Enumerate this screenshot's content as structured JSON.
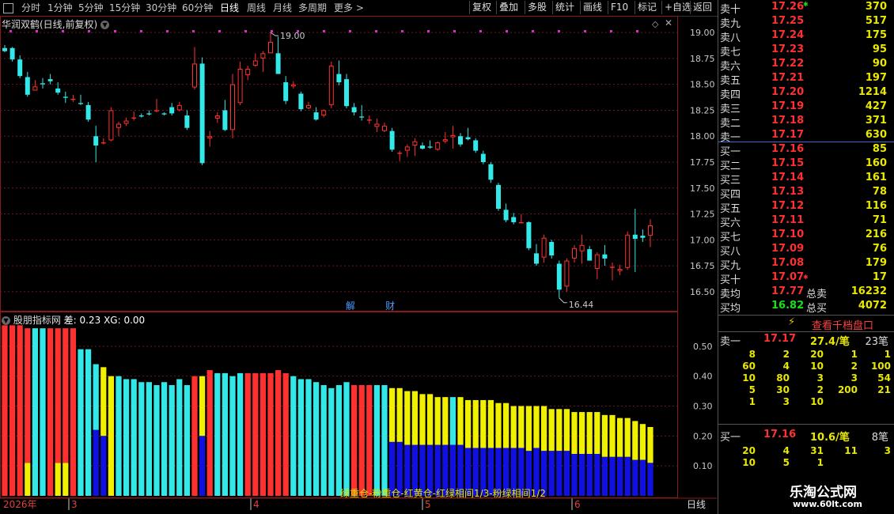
{
  "toolbar": {
    "timeframes": [
      "分时",
      "1分钟",
      "5分钟",
      "15分钟",
      "30分钟",
      "60分钟",
      "日线",
      "周线",
      "月线",
      "多周期",
      "更多 >"
    ],
    "active_timeframe": "日线",
    "buttons": [
      "复权",
      "叠加",
      "多股",
      "统计",
      "画线",
      "F10",
      "标记",
      "+自选",
      "返回"
    ]
  },
  "main_chart": {
    "title": "华润双鹤(日线,前复权)",
    "y_ticks": [
      "19.00",
      "18.75",
      "18.50",
      "18.25",
      "18.00",
      "17.75",
      "17.50",
      "17.25",
      "17.00",
      "16.75",
      "16.50"
    ],
    "high_label": "19.00",
    "low_label": "16.44",
    "event_markers": [
      "解",
      "财"
    ]
  },
  "sub_chart": {
    "name": "股朋指标网",
    "readout": "差: 0.23 XG: 0.00",
    "y_ticks": [
      "0.50",
      "0.40",
      "0.30",
      "0.20",
      "0.10"
    ],
    "legend": "绿重仓-粉重仓-红黄仓-红绿相间1/3-粉绿相间1/2"
  },
  "date_axis": {
    "year_label": "2026年",
    "months": [
      "3",
      "4",
      "5",
      "6"
    ],
    "period": "日线"
  },
  "order_book": {
    "asks": [
      {
        "label": "卖十",
        "price": "17.26",
        "vol": "370"
      },
      {
        "label": "卖九",
        "price": "17.25",
        "vol": "517"
      },
      {
        "label": "卖八",
        "price": "17.24",
        "vol": "175"
      },
      {
        "label": "卖七",
        "price": "17.23",
        "vol": "95"
      },
      {
        "label": "卖六",
        "price": "17.22",
        "vol": "90"
      },
      {
        "label": "卖五",
        "price": "17.21",
        "vol": "197"
      },
      {
        "label": "卖四",
        "price": "17.20",
        "vol": "1214"
      },
      {
        "label": "卖三",
        "price": "17.19",
        "vol": "427"
      },
      {
        "label": "卖二",
        "price": "17.18",
        "vol": "371"
      },
      {
        "label": "卖一",
        "price": "17.17",
        "vol": "630"
      }
    ],
    "bids": [
      {
        "label": "买一",
        "price": "17.16",
        "vol": "85"
      },
      {
        "label": "买二",
        "price": "17.15",
        "vol": "160"
      },
      {
        "label": "买三",
        "price": "17.14",
        "vol": "161"
      },
      {
        "label": "买四",
        "price": "17.13",
        "vol": "78"
      },
      {
        "label": "买五",
        "price": "17.12",
        "vol": "116"
      },
      {
        "label": "买六",
        "price": "17.11",
        "vol": "71"
      },
      {
        "label": "买七",
        "price": "17.10",
        "vol": "216"
      },
      {
        "label": "买八",
        "price": "17.09",
        "vol": "76"
      },
      {
        "label": "买九",
        "price": "17.08",
        "vol": "179"
      },
      {
        "label": "买十",
        "price": "17.07",
        "vol": "17"
      }
    ],
    "avg_sell": {
      "label": "卖均",
      "price": "17.77",
      "total_label": "总卖",
      "total": "16232"
    },
    "avg_buy": {
      "label": "买均",
      "price": "16.82",
      "total_label": "总买",
      "total": "4072"
    },
    "view_button": "查看千档盘口",
    "sell1_detail": {
      "label": "卖一",
      "price": "17.17",
      "avg": "27.4/笔",
      "count": "23笔",
      "grid": [
        [
          "8",
          "2",
          "20",
          "1",
          "1"
        ],
        [
          "60",
          "4",
          "10",
          "2",
          "100"
        ],
        [
          "10",
          "80",
          "3",
          "3",
          "54"
        ],
        [
          "5",
          "30",
          "2",
          "200",
          "21"
        ],
        [
          "1",
          "3",
          "10",
          "",
          ""
        ]
      ]
    },
    "buy1_detail": {
      "label": "买一",
      "price": "17.16",
      "avg": "10.6/笔",
      "count": "8笔",
      "grid": [
        [
          "20",
          "4",
          "31",
          "11",
          "3"
        ],
        [
          "10",
          "5",
          "1",
          "",
          ""
        ]
      ]
    }
  },
  "watermark": {
    "name": "乐淘公式网",
    "url": "www.60lt.com"
  },
  "colors": {
    "up": "#ff3030",
    "down": "#33e8e8",
    "blue": "#1010e0",
    "yellow": "#f0f000",
    "axis": "#8a1a1a",
    "grid": "#6a1a1a"
  },
  "chart_data": {
    "type": "candlestick",
    "ohlc": [
      [
        18.85,
        18.88,
        18.81,
        18.82
      ],
      [
        18.85,
        18.86,
        18.72,
        18.74
      ],
      [
        18.74,
        18.78,
        18.56,
        18.58
      ],
      [
        18.57,
        18.62,
        18.38,
        18.4
      ],
      [
        18.44,
        18.54,
        18.45,
        18.48
      ],
      [
        18.51,
        18.56,
        18.46,
        18.5
      ],
      [
        18.55,
        18.6,
        18.5,
        18.53
      ],
      [
        18.46,
        18.52,
        18.4,
        18.42
      ],
      [
        18.38,
        18.43,
        18.32,
        18.37
      ],
      [
        18.35,
        18.4,
        18.33,
        18.36
      ],
      [
        18.32,
        18.4,
        18.3,
        18.31
      ],
      [
        18.3,
        18.33,
        18.14,
        18.16
      ],
      [
        18.0,
        18.1,
        17.75,
        17.91
      ],
      [
        17.93,
        17.98,
        17.92,
        17.94
      ],
      [
        17.96,
        18.28,
        17.95,
        18.25
      ],
      [
        18.08,
        18.14,
        18.0,
        18.12
      ],
      [
        18.12,
        18.18,
        18.1,
        18.15
      ],
      [
        18.17,
        18.24,
        18.15,
        18.18
      ],
      [
        18.2,
        18.22,
        18.18,
        18.19
      ],
      [
        18.22,
        18.25,
        18.2,
        18.21
      ],
      [
        18.24,
        18.36,
        18.23,
        18.25
      ],
      [
        18.22,
        18.23,
        18.2,
        18.21
      ],
      [
        18.28,
        18.32,
        18.2,
        18.22
      ],
      [
        18.25,
        18.33,
        18.24,
        18.3
      ],
      [
        18.2,
        18.25,
        18.06,
        18.08
      ],
      [
        18.47,
        18.86,
        18.45,
        18.7
      ],
      [
        18.7,
        18.76,
        17.72,
        17.74
      ],
      [
        17.98,
        18.05,
        17.9,
        18.0
      ],
      [
        18.17,
        18.23,
        18.13,
        18.2
      ],
      [
        18.25,
        18.35,
        18.05,
        18.06
      ],
      [
        18.06,
        18.6,
        17.98,
        18.5
      ],
      [
        18.32,
        18.72,
        18.3,
        18.65
      ],
      [
        18.59,
        18.68,
        18.54,
        18.65
      ],
      [
        18.68,
        18.8,
        18.67,
        18.73
      ],
      [
        18.75,
        18.82,
        18.62,
        18.8
      ],
      [
        18.8,
        19.0,
        18.82,
        18.91
      ],
      [
        18.8,
        18.96,
        18.76,
        18.6
      ],
      [
        18.52,
        18.58,
        18.31,
        18.34
      ],
      [
        18.48,
        18.53,
        18.46,
        18.5
      ],
      [
        18.41,
        18.43,
        18.24,
        18.26
      ],
      [
        18.27,
        18.33,
        18.26,
        18.3
      ],
      [
        18.23,
        18.28,
        18.15,
        18.16
      ],
      [
        18.2,
        18.26,
        18.18,
        18.25
      ],
      [
        18.3,
        18.72,
        18.27,
        18.68
      ],
      [
        18.6,
        18.73,
        18.49,
        18.52
      ],
      [
        18.55,
        18.6,
        18.27,
        18.29
      ],
      [
        18.28,
        18.32,
        18.2,
        18.23
      ],
      [
        18.19,
        18.3,
        18.15,
        18.18
      ],
      [
        18.15,
        18.2,
        18.12,
        18.16
      ],
      [
        18.09,
        18.17,
        18.04,
        18.12
      ],
      [
        18.05,
        18.13,
        18.04,
        18.1
      ],
      [
        18.05,
        18.08,
        17.85,
        17.87
      ],
      [
        17.83,
        17.86,
        17.76,
        17.84
      ],
      [
        17.86,
        17.92,
        17.8,
        17.9
      ],
      [
        17.91,
        17.98,
        17.81,
        17.95
      ],
      [
        17.91,
        17.94,
        17.87,
        17.88
      ],
      [
        17.9,
        17.96,
        17.88,
        17.89
      ],
      [
        17.87,
        17.95,
        17.86,
        17.94
      ],
      [
        17.95,
        18.04,
        17.93,
        17.97
      ],
      [
        17.99,
        18.1,
        17.88,
        18.01
      ],
      [
        18.0,
        18.03,
        17.9,
        17.92
      ],
      [
        17.99,
        18.08,
        17.96,
        17.97
      ],
      [
        17.96,
        17.98,
        17.84,
        17.86
      ],
      [
        17.83,
        17.86,
        17.73,
        17.75
      ],
      [
        17.73,
        17.75,
        17.55,
        17.58
      ],
      [
        17.53,
        17.55,
        17.28,
        17.3
      ],
      [
        17.29,
        17.35,
        17.17,
        17.19
      ],
      [
        17.22,
        17.26,
        17.15,
        17.17
      ],
      [
        17.16,
        17.25,
        17.16,
        17.17
      ],
      [
        17.17,
        17.18,
        16.9,
        16.92
      ],
      [
        16.87,
        16.96,
        16.75,
        16.77
      ],
      [
        16.83,
        17.05,
        16.78,
        17.02
      ],
      [
        16.98,
        17.0,
        16.82,
        16.85
      ],
      [
        16.77,
        16.8,
        16.44,
        16.52
      ],
      [
        16.55,
        16.82,
        16.5,
        16.8
      ],
      [
        16.82,
        16.95,
        16.78,
        16.92
      ],
      [
        16.89,
        17.05,
        16.77,
        16.95
      ],
      [
        16.91,
        16.94,
        16.8,
        16.8
      ],
      [
        16.72,
        16.88,
        16.62,
        16.86
      ],
      [
        16.86,
        16.95,
        16.75,
        16.82
      ],
      [
        16.73,
        16.78,
        16.61,
        16.74
      ],
      [
        16.7,
        16.76,
        16.66,
        16.72
      ],
      [
        16.73,
        17.08,
        16.71,
        17.05
      ],
      [
        17.05,
        17.3,
        16.69,
        17.01
      ],
      [
        17.04,
        17.1,
        16.98,
        17.02
      ],
      [
        17.04,
        17.2,
        16.93,
        17.14
      ]
    ],
    "indicator": {
      "top": [
        0.57,
        0.57,
        0.57,
        0.56,
        0.56,
        0.56,
        0.56,
        0.56,
        0.56,
        0.56,
        0.49,
        0.49,
        0.44,
        0.43,
        0.4,
        0.4,
        0.39,
        0.39,
        0.38,
        0.38,
        0.37,
        0.38,
        0.37,
        0.39,
        0.37,
        0.4,
        0.4,
        0.42,
        0.41,
        0.41,
        0.4,
        0.41,
        0.41,
        0.41,
        0.41,
        0.41,
        0.42,
        0.41,
        0.4,
        0.39,
        0.39,
        0.38,
        0.37,
        0.36,
        0.37,
        0.38,
        0.37,
        0.37,
        0.37,
        0.37,
        0.37,
        0.36,
        0.36,
        0.35,
        0.35,
        0.34,
        0.34,
        0.33,
        0.33,
        0.33,
        0.33,
        0.32,
        0.32,
        0.32,
        0.32,
        0.31,
        0.31,
        0.3,
        0.3,
        0.3,
        0.3,
        0.3,
        0.29,
        0.29,
        0.29,
        0.28,
        0.28,
        0.28,
        0.28,
        0.27,
        0.27,
        0.26,
        0.26,
        0.25,
        0.24,
        0.23
      ],
      "bottom": [
        0.0,
        0.0,
        0.0,
        0.11,
        0.0,
        0.0,
        0.0,
        0.11,
        0.11,
        0.0,
        0.0,
        0.0,
        0.22,
        0.2,
        0.0,
        0.0,
        0.0,
        0.0,
        0.0,
        0.0,
        0.0,
        0.0,
        0.0,
        0.0,
        0.0,
        0.0,
        0.2,
        0.0,
        0.0,
        0.0,
        0.0,
        0.0,
        0.0,
        0.0,
        0.0,
        0.0,
        0.0,
        0.0,
        0.0,
        0.0,
        0.0,
        0.0,
        0.0,
        0.0,
        0.0,
        0.0,
        0.0,
        0.0,
        0.0,
        0.0,
        0.0,
        0.18,
        0.18,
        0.17,
        0.17,
        0.17,
        0.17,
        0.17,
        0.17,
        0.17,
        0.17,
        0.16,
        0.16,
        0.16,
        0.16,
        0.16,
        0.16,
        0.16,
        0.16,
        0.15,
        0.16,
        0.15,
        0.15,
        0.15,
        0.15,
        0.14,
        0.14,
        0.14,
        0.14,
        0.13,
        0.13,
        0.13,
        0.13,
        0.12,
        0.12,
        0.11
      ],
      "kind": [
        "r",
        "r",
        "r",
        "ry",
        "c",
        "c",
        "r",
        "ry",
        "ry",
        "r",
        "c",
        "c",
        "cb",
        "yb",
        "y",
        "c",
        "c",
        "c",
        "c",
        "c",
        "c",
        "c",
        "c",
        "c",
        "c",
        "r",
        "yb",
        "r",
        "c",
        "c",
        "c",
        "c",
        "r",
        "r",
        "r",
        "r",
        "r",
        "r",
        "c",
        "c",
        "c",
        "c",
        "c",
        "c",
        "c",
        "c",
        "r",
        "r",
        "r",
        "c",
        "c",
        "yb",
        "yb",
        "yb",
        "yb",
        "yb",
        "yb",
        "yb",
        "yb",
        "cb",
        "yb",
        "yb",
        "yb",
        "yb",
        "yb",
        "yb",
        "yb",
        "yb",
        "yb",
        "yb",
        "yb",
        "yb",
        "yb",
        "yb",
        "yb",
        "yb",
        "yb",
        "yb",
        "yb",
        "yb",
        "yb",
        "yb",
        "yb",
        "yb",
        "yb",
        "yb"
      ]
    },
    "ylim_price": [
      16.4,
      19.1
    ],
    "ylim_indicator": [
      0.0,
      0.6
    ]
  }
}
